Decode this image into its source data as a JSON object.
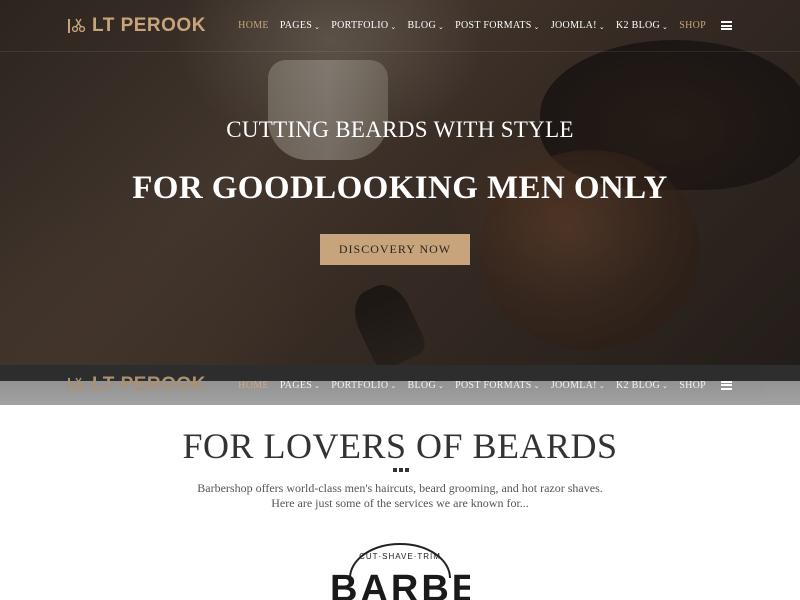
{
  "brand": {
    "name": "LT PEROOK"
  },
  "nav": {
    "items": [
      {
        "label": "HOME",
        "dropdown": false
      },
      {
        "label": "PAGES",
        "dropdown": true
      },
      {
        "label": "PORTFOLIO",
        "dropdown": true
      },
      {
        "label": "BLOG",
        "dropdown": true
      },
      {
        "label": "POST FORMATS",
        "dropdown": true
      },
      {
        "label": "JOOMLA!",
        "dropdown": true
      },
      {
        "label": "K2 BLOG",
        "dropdown": true
      },
      {
        "label": "SHOP",
        "dropdown": false
      }
    ],
    "active": "HOME"
  },
  "hero": {
    "subtitle": "CUTTING BEARDS WITH STYLE",
    "title": "FOR GOODLOOKING MEN ONLY",
    "button": "DISCOVERY NOW"
  },
  "section": {
    "title": "FOR LOVERS OF BEARDS",
    "desc_line1": "Barbershop offers world-class men's haircuts, beard grooming, and hot razor shaves.",
    "desc_line2": "Here are just some of the services we are known for..."
  },
  "badge": {
    "arc_text": "CUT·SHAVE·TRIM",
    "word": "BARBER"
  },
  "colors": {
    "accent": "#c8a47c",
    "text_dark": "#333333",
    "button_text": "#2b2420"
  }
}
